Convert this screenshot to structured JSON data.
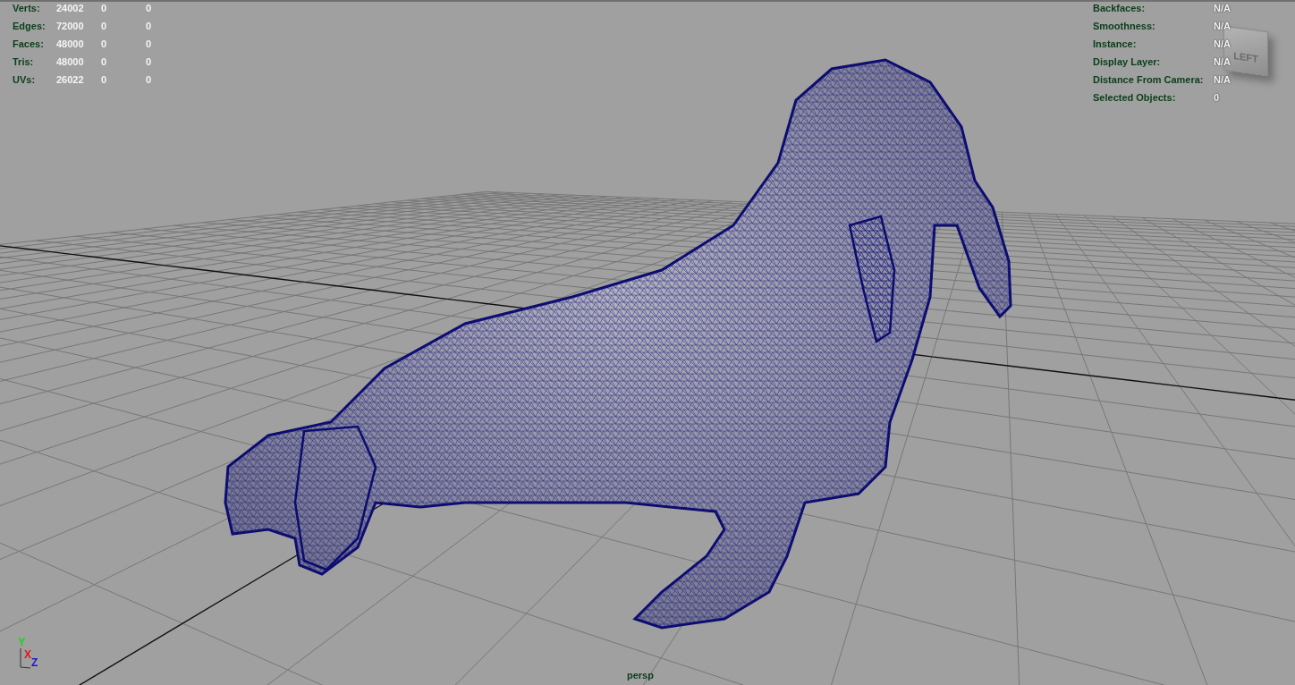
{
  "poly_count": {
    "rows": [
      {
        "label": "Verts:",
        "values": [
          "24002",
          "0",
          "0"
        ]
      },
      {
        "label": "Edges:",
        "values": [
          "72000",
          "0",
          "0"
        ]
      },
      {
        "label": "Faces:",
        "values": [
          "48000",
          "0",
          "0"
        ]
      },
      {
        "label": "Tris:",
        "values": [
          "48000",
          "0",
          "0"
        ]
      },
      {
        "label": "UVs:",
        "values": [
          "26022",
          "0",
          "0"
        ]
      }
    ]
  },
  "object_details": {
    "rows": [
      {
        "label": "Backfaces:",
        "value": "N/A"
      },
      {
        "label": "Smoothness:",
        "value": "N/A"
      },
      {
        "label": "Instance:",
        "value": "N/A"
      },
      {
        "label": "Display Layer:",
        "value": "N/A"
      },
      {
        "label": "Distance From Camera:",
        "value": "N/A"
      },
      {
        "label": "Selected Objects:",
        "value": "0"
      }
    ]
  },
  "view_cube": {
    "face_label": "LEFT"
  },
  "axis_gizmo": {
    "axes": [
      {
        "label": "Y",
        "color": "#1fd01f"
      },
      {
        "label": "X",
        "color": "#e01818"
      },
      {
        "label": "Z",
        "color": "#1818d8"
      }
    ]
  },
  "camera_name": "persp"
}
